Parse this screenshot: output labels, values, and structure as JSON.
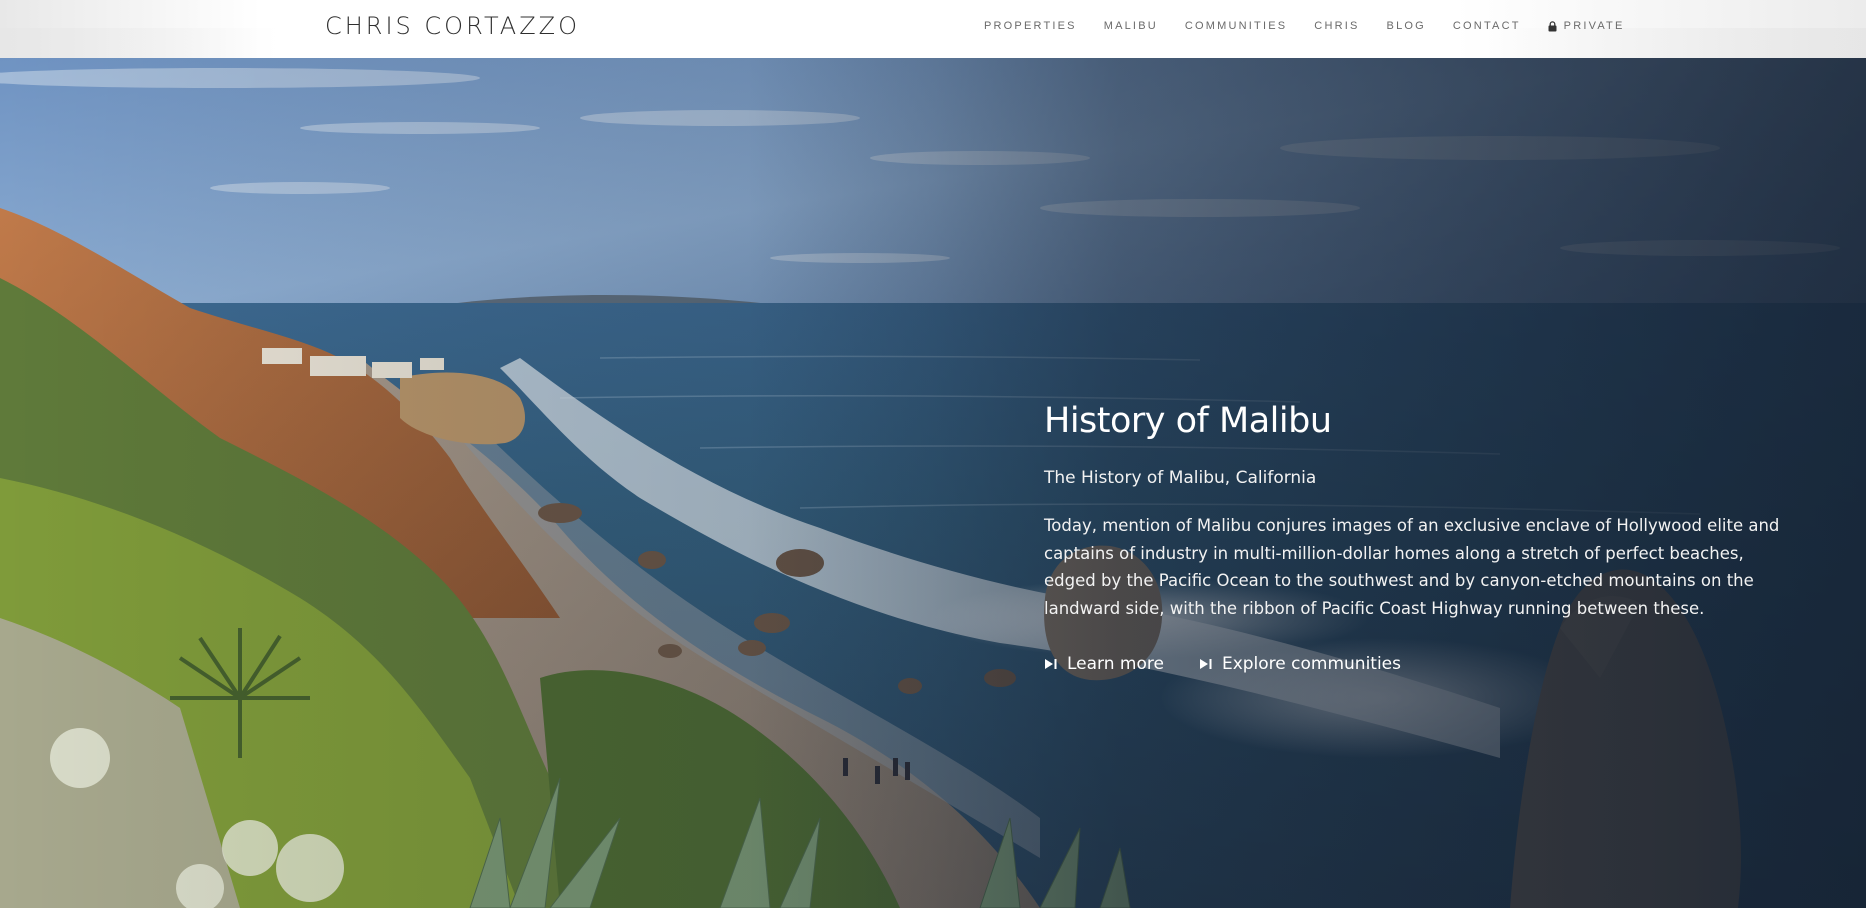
{
  "header": {
    "logo": "CHRIS CORTAZZO",
    "nav": [
      {
        "label": "PROPERTIES"
      },
      {
        "label": "MALIBU"
      },
      {
        "label": "COMMUNITIES"
      },
      {
        "label": "CHRIS"
      },
      {
        "label": "BLOG"
      },
      {
        "label": "CONTACT"
      },
      {
        "label": "PRIVATE",
        "icon": "lock-icon"
      }
    ]
  },
  "hero": {
    "title": "History of Malibu",
    "subtitle": "The History of Malibu, California",
    "body": "Today, mention of Malibu conjures images of an exclusive enclave of Hollywood elite and captains of industry in multi-million-dollar homes along a stretch of perfect beaches, edged by the Pacific Ocean to the southwest and by canyon-etched mountains on the landward side, with the ribbon of Pacific Coast Highway running between these.",
    "links": [
      {
        "label": "Learn more",
        "icon": "play-next-icon"
      },
      {
        "label": "Explore communities",
        "icon": "play-next-icon"
      }
    ],
    "image": "coastal-beach-photo"
  }
}
